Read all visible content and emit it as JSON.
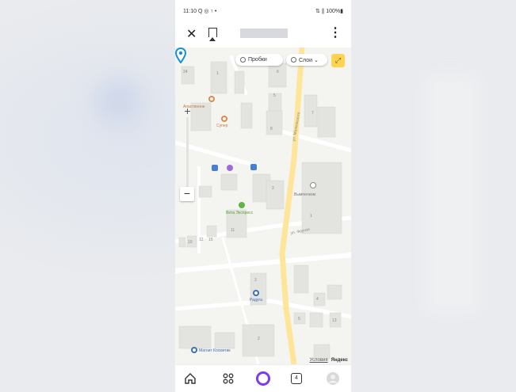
{
  "status_bar": {
    "time_icons": "11:10 Q ◎ ↑ •",
    "right_icons": "⇅ ∥ 100%▮"
  },
  "browser": {
    "close_glyph": "✕",
    "menu_glyph": "⋮"
  },
  "map": {
    "chips": {
      "traffic_label": "Пробки",
      "layers_label": "Слои ⌄"
    },
    "zoom": {
      "plus": "+",
      "minus": "−"
    },
    "pois": {
      "poi_1": "Апастиноне",
      "poi_2": "Супер",
      "pharmacy": "Вита Экспресс",
      "shop_bottom": "Магнит Косметик",
      "poi_4": "Радуга",
      "bank_label": "Вымпелком"
    },
    "streets": {
      "main_street": "ул. Маяковского",
      "side_street": "ул. Фрунзе"
    },
    "house_numbers": [
      "24",
      "1",
      "6",
      "5",
      "8",
      "7",
      "2",
      "1",
      "11",
      "12",
      "10",
      "15",
      "3",
      "4",
      "5",
      "13",
      "2",
      "1",
      "5",
      "3",
      "10"
    ],
    "credit": {
      "terms": "Условия",
      "brand": "Яндекс"
    }
  },
  "colors": {
    "road": "#ffe59a",
    "map_bg": "#f4f4f1",
    "building": "#e3e3e0",
    "accent_yellow": "#ffd34d",
    "alice_purple": "#7b3cf0"
  },
  "bottom_nav": {
    "items": [
      "home-icon",
      "apps-grid-icon",
      "alice-icon",
      "tabs-icon",
      "profile-icon"
    ],
    "tabs_count": "4"
  }
}
